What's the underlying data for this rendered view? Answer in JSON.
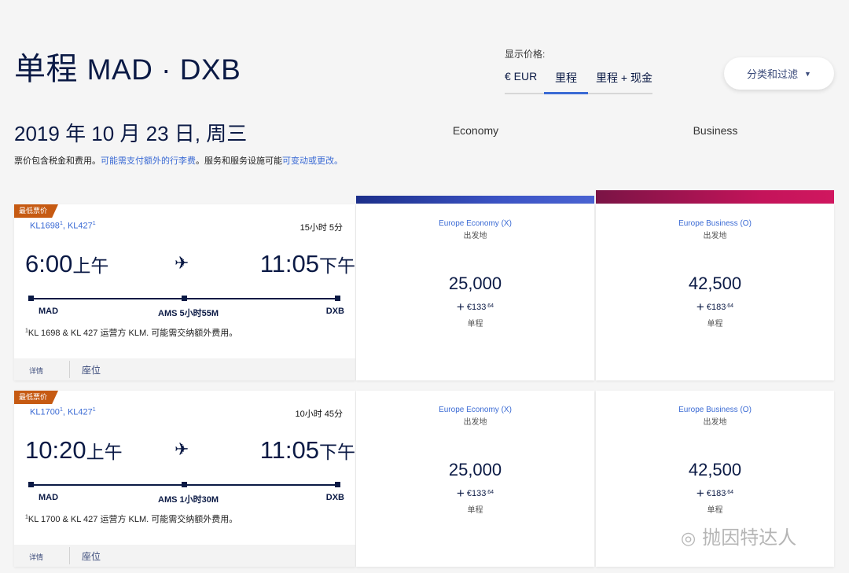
{
  "header": {
    "trip_type": "单程",
    "route": "MAD · DXB"
  },
  "price_display": {
    "label": "显示价格:",
    "options": [
      "€ EUR",
      "里程",
      "里程 + 现金"
    ],
    "selected": "里程"
  },
  "filter_button": "分类和过滤",
  "date": "2019 年 10 月 23 日, 周三",
  "note": {
    "text": "票价包含税金和费用。",
    "link1": "可能需支付额外的行李费",
    "text2": "。服务和服务设施可能",
    "link2": "可变动或更改。"
  },
  "columns": [
    "Economy",
    "Business"
  ],
  "colors": {
    "economy_bar": "#3b53c4",
    "business_bar": "#c4145a",
    "badge": "#c65a12",
    "link": "#3a6ad4"
  },
  "flights": [
    {
      "badge": "最低票价",
      "flight1": "KL1698",
      "flight2": "KL427",
      "sup": "1",
      "duration": "15小时 5分",
      "dep_time": "6:00",
      "dep_ampm": "上午",
      "arr_time": "11:05",
      "arr_ampm": "下午",
      "origin": "MAD",
      "stop": "AMS 5小时55M",
      "destination": "DXB",
      "operator_note": "KL 1698 & KL 427 运营方 KLM. 可能需交纳额外费用。",
      "details": "详情",
      "seats": "座位",
      "fares": [
        {
          "cabin": "Europe Economy (X)",
          "origin_label": "出发地",
          "miles": "25,000",
          "cash": "€133",
          "cash_cents": ".64",
          "trip": "单程"
        },
        {
          "cabin": "Europe Business (O)",
          "origin_label": "出发地",
          "miles": "42,500",
          "cash": "€183",
          "cash_cents": ".64",
          "trip": "单程"
        }
      ]
    },
    {
      "badge": "最低票价",
      "flight1": "KL1700",
      "flight2": "KL427",
      "sup": "1",
      "duration": "10小时 45分",
      "dep_time": "10:20",
      "dep_ampm": "上午",
      "arr_time": "11:05",
      "arr_ampm": "下午",
      "origin": "MAD",
      "stop": "AMS 1小时30M",
      "destination": "DXB",
      "operator_note": "KL 1700 & KL 427 运营方 KLM. 可能需交纳额外费用。",
      "details": "详情",
      "seats": "座位",
      "fares": [
        {
          "cabin": "Europe Economy (X)",
          "origin_label": "出发地",
          "miles": "25,000",
          "cash": "€133",
          "cash_cents": ".64",
          "trip": "单程"
        },
        {
          "cabin": "Europe Business (O)",
          "origin_label": "出发地",
          "miles": "42,500",
          "cash": "€183",
          "cash_cents": ".64",
          "trip": "单程"
        }
      ]
    }
  ],
  "watermark": "抛因特达人"
}
